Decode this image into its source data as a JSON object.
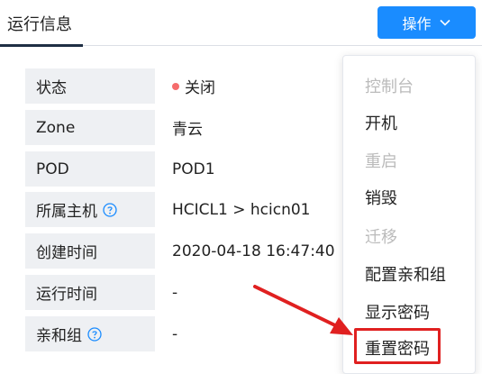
{
  "tab": {
    "title": "运行信息"
  },
  "operations_button": {
    "label": "操作",
    "color": "#1a8cff"
  },
  "info_rows": [
    {
      "label": "状态",
      "value": "关闭",
      "status_color": "#f56c6c"
    },
    {
      "label": "Zone",
      "value": "青云"
    },
    {
      "label": "POD",
      "value": "POD1"
    },
    {
      "label": "所属主机",
      "value": "HCICL1 > hcicn01",
      "has_help": true
    },
    {
      "label": "创建时间",
      "value": "2020-04-18 16:47:40"
    },
    {
      "label": "运行时间",
      "value": "-"
    },
    {
      "label": "亲和组",
      "value": "-",
      "has_help": true
    }
  ],
  "menu": {
    "items": [
      {
        "label": "控制台",
        "disabled": true
      },
      {
        "label": "开机",
        "disabled": false
      },
      {
        "label": "重启",
        "disabled": true
      },
      {
        "label": "销毁",
        "disabled": false
      },
      {
        "label": "迁移",
        "disabled": true
      },
      {
        "label": "配置亲和组",
        "disabled": false
      },
      {
        "label": "显示密码",
        "disabled": false
      },
      {
        "label": "重置密码",
        "disabled": false,
        "highlighted": true
      }
    ]
  },
  "colors": {
    "accent": "#1a8cff",
    "annotation": "#e02020",
    "help_icon": "#1a8cff",
    "label_bg": "#eef0f3"
  }
}
